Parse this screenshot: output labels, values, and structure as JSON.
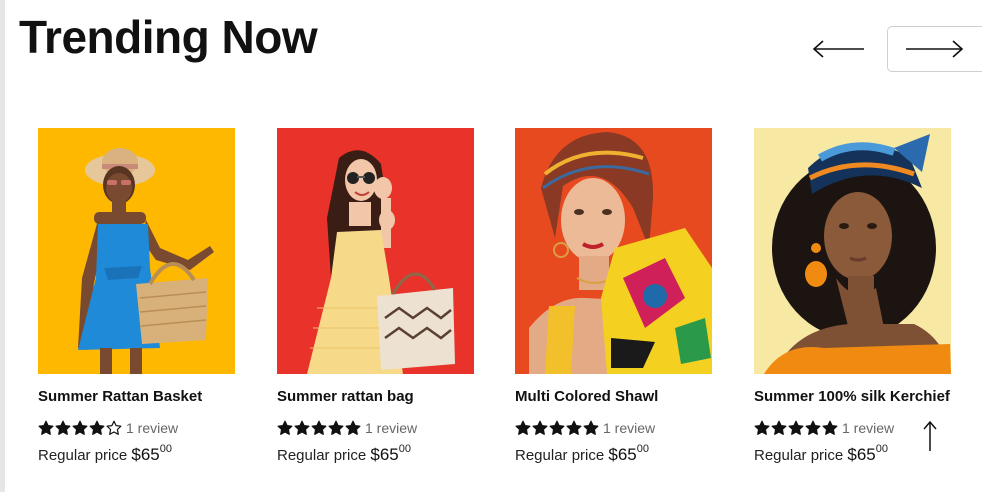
{
  "header": {
    "title": "Trending Now"
  },
  "navigation": {
    "prev_icon": "arrow-left-icon",
    "next_icon": "arrow-right-icon"
  },
  "colors": {
    "text": "#111111",
    "muted": "#666666",
    "card1_bg": "#FFB800",
    "card2_bg": "#E8322A",
    "card3_bg": "#E84A20",
    "card4_bg": "#F7E9A4"
  },
  "products": [
    {
      "name": "Summer Rattan Basket",
      "rating": 4,
      "max_rating": 5,
      "reviews": "1 review",
      "price_label": "Regular price",
      "price_main": "$65",
      "price_cents": "00",
      "image": "woman in blue dress with rattan basket"
    },
    {
      "name": "Summer rattan bag",
      "rating": 5,
      "max_rating": 5,
      "reviews": "1 review",
      "price_label": "Regular price",
      "price_main": "$65",
      "price_cents": "00",
      "image": "woman in yellow dress with woven bag"
    },
    {
      "name": "Multi Colored Shawl",
      "rating": 5,
      "max_rating": 5,
      "reviews": "1 review",
      "price_label": "Regular price",
      "price_main": "$65",
      "price_cents": "00",
      "image": "woman with colorful head scarf"
    },
    {
      "name": "Summer 100% silk Kerchief",
      "rating": 5,
      "max_rating": 5,
      "reviews": "1 review",
      "price_label": "Regular price",
      "price_main": "$65",
      "price_cents": "00",
      "image": "woman with blue silk kerchief"
    }
  ],
  "scroll_top_icon": "arrow-up-icon"
}
